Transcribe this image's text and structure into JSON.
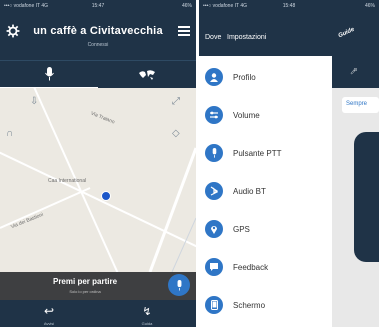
{
  "left": {
    "status": {
      "carrier": "•••○ vodafone IT 4G",
      "time": "15:47",
      "battery": "46% "
    },
    "header": {
      "title": "un caffè a Civitavecchia",
      "subtitle": "Connessi"
    },
    "map": {
      "place_label": "Caa International",
      "streets": [
        "Via Traiano",
        "Via dei Bastioni"
      ]
    },
    "start": {
      "label": "Premi per partire",
      "sub": "Solo io per ordina"
    },
    "bottom": {
      "left_label": "Avvisi",
      "right_label": "Guida"
    }
  },
  "right": {
    "status": {
      "carrier": "•••○ vodafone IT 4G",
      "time": "15:48",
      "battery": "46% "
    },
    "header": {
      "left": "Dove",
      "right": "Impostazioni",
      "brand": "Guide"
    },
    "drawer_items": [
      {
        "label": "Profilo",
        "icon": "user-icon"
      },
      {
        "label": "Volume",
        "icon": "sliders-icon"
      },
      {
        "label": "Pulsante PTT",
        "icon": "mic-icon"
      },
      {
        "label": "Audio BT",
        "icon": "bluetooth-audio-icon"
      },
      {
        "label": "GPS",
        "icon": "location-pin-icon"
      },
      {
        "label": "Feedback",
        "icon": "chat-icon"
      },
      {
        "label": "Schermo",
        "icon": "phone-screen-icon"
      }
    ],
    "behind": {
      "card_label": "Sempre"
    }
  },
  "colors": {
    "navy": "#1f3347",
    "blue": "#2f76c6",
    "drawer_bg": "#ffffff",
    "dark_bar": "#3e3f41"
  }
}
